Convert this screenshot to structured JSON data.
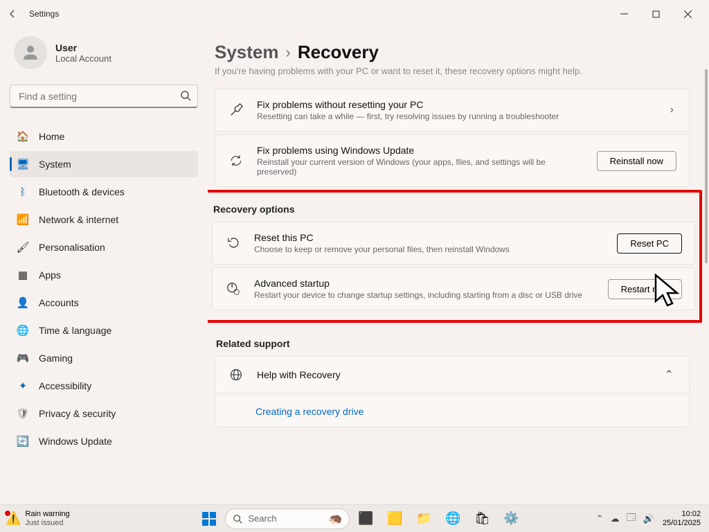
{
  "window": {
    "title": "Settings"
  },
  "user": {
    "name": "User",
    "account": "Local Account"
  },
  "search": {
    "placeholder": "Find a setting"
  },
  "nav": [
    {
      "label": "Home",
      "icon": "🏠"
    },
    {
      "label": "System",
      "icon": "🖥",
      "active": true
    },
    {
      "label": "Bluetooth & devices",
      "icon": "ᛒ"
    },
    {
      "label": "Network & internet",
      "icon": "📶"
    },
    {
      "label": "Personalisation",
      "icon": "🖌"
    },
    {
      "label": "Apps",
      "icon": "▦"
    },
    {
      "label": "Accounts",
      "icon": "👤"
    },
    {
      "label": "Time & language",
      "icon": "🌐"
    },
    {
      "label": "Gaming",
      "icon": "🎮"
    },
    {
      "label": "Accessibility",
      "icon": "✦"
    },
    {
      "label": "Privacy & security",
      "icon": "🛡"
    },
    {
      "label": "Windows Update",
      "icon": "🔄"
    }
  ],
  "breadcrumb": {
    "root": "System",
    "current": "Recovery"
  },
  "subtitle": "If you're having problems with your PC or want to reset it, these recovery options might help.",
  "cards": {
    "fixProblems": {
      "title": "Fix problems without resetting your PC",
      "desc": "Resetting can take a while — first, try resolving issues by running a troubleshooter"
    },
    "fixUpdate": {
      "title": "Fix problems using Windows Update",
      "desc": "Reinstall your current version of Windows (your apps, files, and settings will be preserved)",
      "button": "Reinstall now"
    },
    "reset": {
      "title": "Reset this PC",
      "desc": "Choose to keep or remove your personal files, then reinstall Windows",
      "button": "Reset PC"
    },
    "advanced": {
      "title": "Advanced startup",
      "desc": "Restart your device to change startup settings, including starting from a disc or USB drive",
      "button": "Restart now"
    },
    "help": {
      "title": "Help with Recovery",
      "link": "Creating a recovery drive"
    }
  },
  "sections": {
    "recovery": "Recovery options",
    "related": "Related support"
  },
  "taskbar": {
    "weather": {
      "line1": "Rain warning",
      "line2": "Just issued"
    },
    "search": "Search",
    "time": "10:02",
    "date": "25/01/2025"
  }
}
